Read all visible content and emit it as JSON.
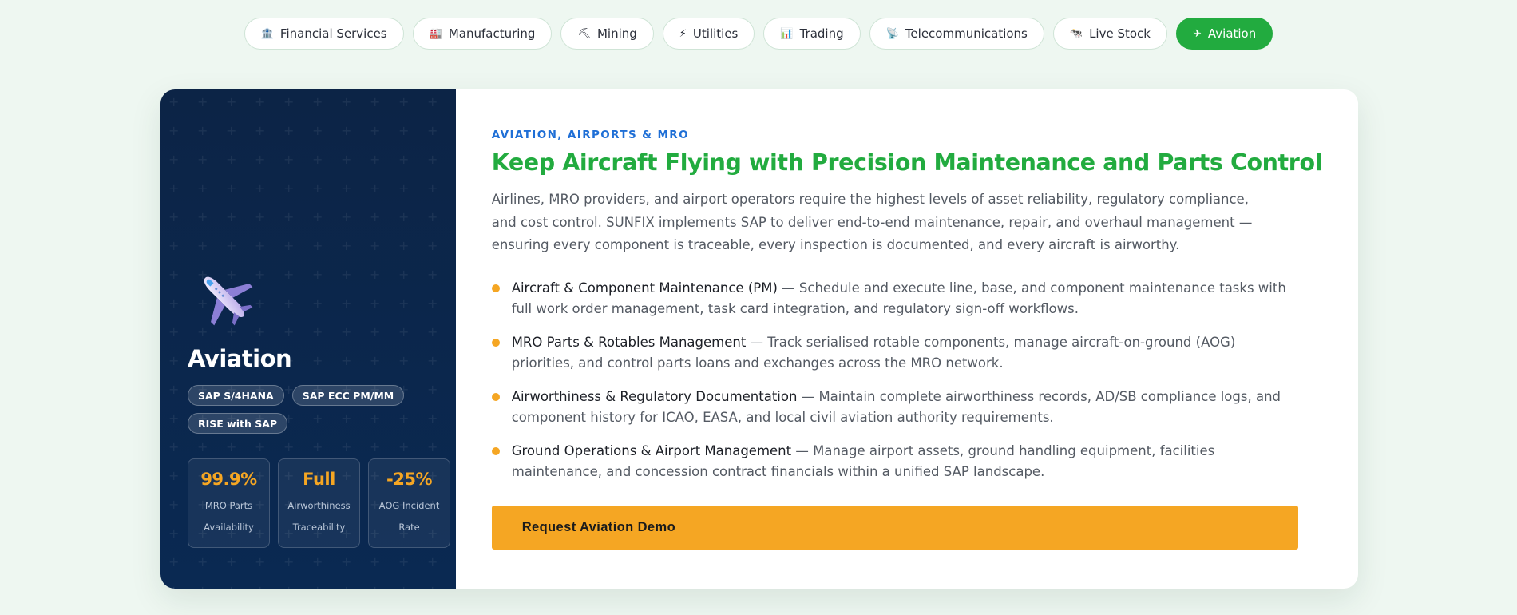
{
  "tabs": [
    {
      "label": "Financial Services",
      "icon": "bank-icon",
      "glyph": "🏦",
      "active": false
    },
    {
      "label": "Manufacturing",
      "icon": "factory-icon",
      "glyph": "🏭",
      "active": false
    },
    {
      "label": "Mining",
      "icon": "pickaxe-icon",
      "glyph": "⛏",
      "active": false
    },
    {
      "label": "Utilities",
      "icon": "lightning-icon",
      "glyph": "⚡",
      "active": false
    },
    {
      "label": "Trading",
      "icon": "bar-chart-icon",
      "glyph": "📊",
      "active": false
    },
    {
      "label": "Telecommunications",
      "icon": "satellite-icon",
      "glyph": "📡",
      "active": false
    },
    {
      "label": "Live Stock",
      "icon": "cow-icon",
      "glyph": "🐄",
      "active": false
    },
    {
      "label": "Aviation",
      "icon": "airplane-icon",
      "glyph": "✈",
      "active": true
    }
  ],
  "panel": {
    "icon": "airplane-icon",
    "name": "Aviation",
    "chips": [
      "SAP S/4HANA",
      "SAP ECC PM/MM",
      "RISE with SAP"
    ],
    "stats": [
      {
        "value": "99.9%",
        "label": "MRO Parts Availability"
      },
      {
        "value": "Full",
        "label": "Airworthiness Traceability"
      },
      {
        "value": "-25%",
        "label": "AOG Incident Rate"
      }
    ]
  },
  "content": {
    "eyebrow": "AVIATION, AIRPORTS & MRO",
    "headline": "Keep Aircraft Flying with Precision Maintenance and Parts Control",
    "intro": "Airlines, MRO providers, and airport operators require the highest levels of asset reliability, regulatory compliance, and cost control. SUNFIX implements SAP to deliver end-to-end maintenance, repair, and overhaul management — ensuring every component is traceable, every inspection is documented, and every aircraft is airworthy.",
    "features": [
      {
        "title": "Aircraft & Component Maintenance (PM)",
        "text": " — Schedule and execute line, base, and component maintenance tasks with full work order management, task card integration, and regulatory sign-off workflows."
      },
      {
        "title": "MRO Parts & Rotables Management",
        "text": " — Track serialised rotable components, manage aircraft-on-ground (AOG) priorities, and control parts loans and exchanges across the MRO network."
      },
      {
        "title": "Airworthiness & Regulatory Documentation",
        "text": " — Maintain complete airworthiness records, AD/SB compliance logs, and component history for ICAO, EASA, and local civil aviation authority requirements."
      },
      {
        "title": "Ground Operations & Airport Management",
        "text": " — Manage airport assets, ground handling equipment, facilities maintenance, and concession contract financials within a unified SAP landscape."
      }
    ],
    "cta_label": "Request Aviation Demo"
  },
  "colors": {
    "accent_green": "#22ab3f",
    "accent_orange": "#f5a623",
    "eyebrow_blue": "#1f6fd6",
    "panel_navy": "#0c2446",
    "page_bg": "#eef7f1"
  }
}
